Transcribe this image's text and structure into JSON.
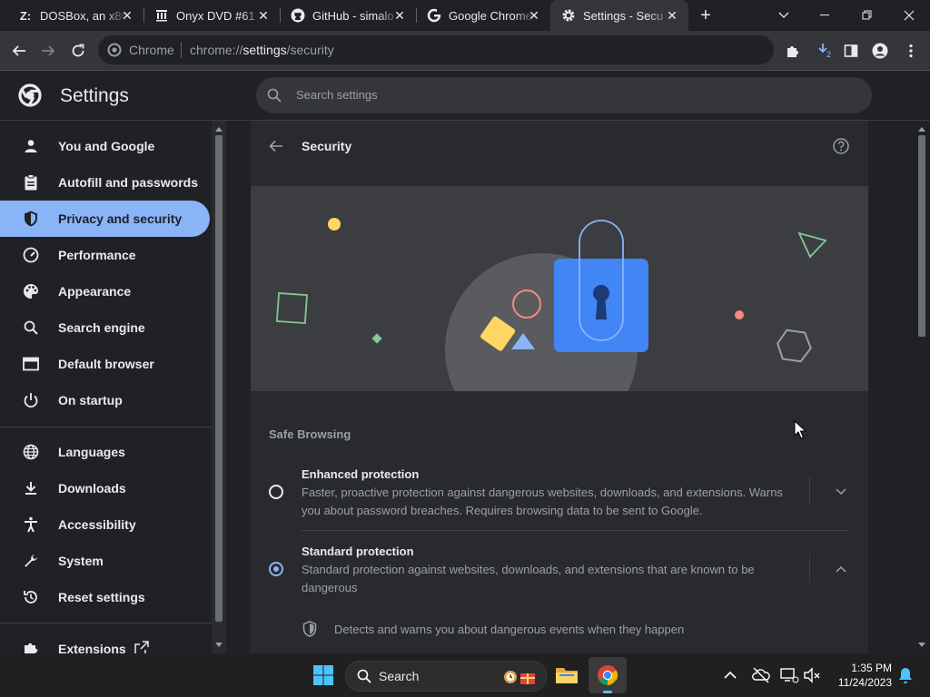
{
  "tabs": [
    {
      "title": "DOSBox, an x86",
      "icon": "zdnet-z-icon",
      "fav_text": "Z:"
    },
    {
      "title": "Onyx DVD #61",
      "icon": "archive-org-icon"
    },
    {
      "title": "GitHub - simalo",
      "icon": "github-icon"
    },
    {
      "title": "Google Chrome",
      "icon": "google-icon"
    },
    {
      "title": "Settings - Secu",
      "icon": "gear-icon"
    }
  ],
  "omnibox": {
    "chip": "Chrome",
    "url_scheme": "chrome://",
    "url_host": "settings",
    "url_path": "/security"
  },
  "download_badge": "2",
  "header": {
    "title": "Settings",
    "search_placeholder": "Search settings"
  },
  "sidebar": {
    "items": [
      {
        "label": "You and Google",
        "icon": "person-icon"
      },
      {
        "label": "Autofill and passwords",
        "icon": "clipboard-icon"
      },
      {
        "label": "Privacy and security",
        "icon": "shield-icon",
        "active": true
      },
      {
        "label": "Performance",
        "icon": "speedometer-icon"
      },
      {
        "label": "Appearance",
        "icon": "palette-icon"
      },
      {
        "label": "Search engine",
        "icon": "search-icon"
      },
      {
        "label": "Default browser",
        "icon": "browser-window-icon"
      },
      {
        "label": "On startup",
        "icon": "power-icon"
      },
      {
        "label": "Languages",
        "icon": "globe-icon"
      },
      {
        "label": "Downloads",
        "icon": "download-icon"
      },
      {
        "label": "Accessibility",
        "icon": "accessibility-icon"
      },
      {
        "label": "System",
        "icon": "wrench-icon"
      },
      {
        "label": "Reset settings",
        "icon": "reset-icon"
      },
      {
        "label": "Extensions",
        "icon": "puzzle-icon"
      }
    ]
  },
  "page": {
    "title": "Security",
    "section": "Safe Browsing",
    "options": [
      {
        "title": "Enhanced protection",
        "desc_line1": "Faster, proactive protection against dangerous websites, downloads, and extensions. Warns",
        "desc_line2": "you about password breaches. Requires browsing data to be sent to Google.",
        "selected": false
      },
      {
        "title": "Standard protection",
        "desc_line1": "Standard protection against websites, downloads, and extensions that are known to be",
        "desc_line2": "dangerous",
        "selected": true
      }
    ],
    "detail": "Detects and warns you about dangerous events when they happen"
  },
  "taskbar": {
    "search_label": "Search",
    "time": "1:35 PM",
    "date": "11/24/2023"
  },
  "colors": {
    "accent": "#8ab4f8",
    "lock_blue": "#4285f4",
    "bg": "#202124",
    "card": "#292a2d"
  }
}
